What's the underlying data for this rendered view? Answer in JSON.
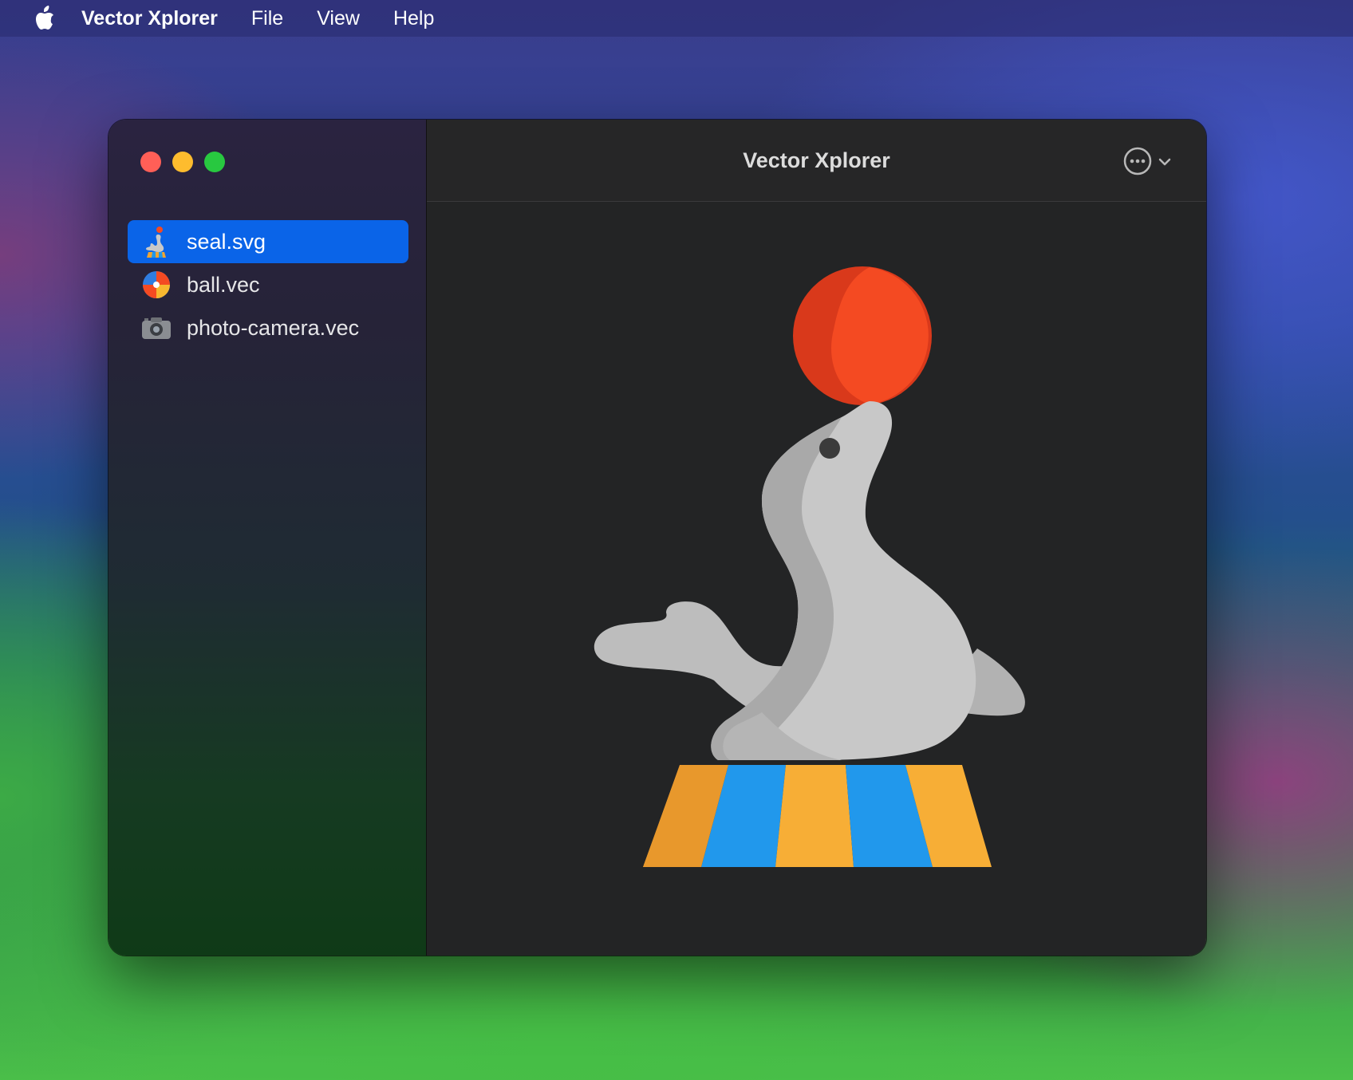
{
  "menubar": {
    "apple_icon": "apple-logo-icon",
    "app_name": "Vector Xplorer",
    "items": [
      "File",
      "View",
      "Help"
    ]
  },
  "window": {
    "title": "Vector Xplorer",
    "more_icon": "ellipsis-circle-icon",
    "chevron_icon": "chevron-down-icon"
  },
  "sidebar": {
    "files": [
      {
        "name": "seal.svg",
        "icon": "seal-file-icon",
        "selected": true
      },
      {
        "name": "ball.vec",
        "icon": "ball-file-icon",
        "selected": false
      },
      {
        "name": "photo-camera.vec",
        "icon": "camera-file-icon",
        "selected": false
      }
    ]
  },
  "colors": {
    "accent": "#0a64e8",
    "ball": "#f44a22",
    "seal": "#c4c4c4",
    "stripe_orange": "#f0a431",
    "stripe_blue": "#2198ec"
  }
}
